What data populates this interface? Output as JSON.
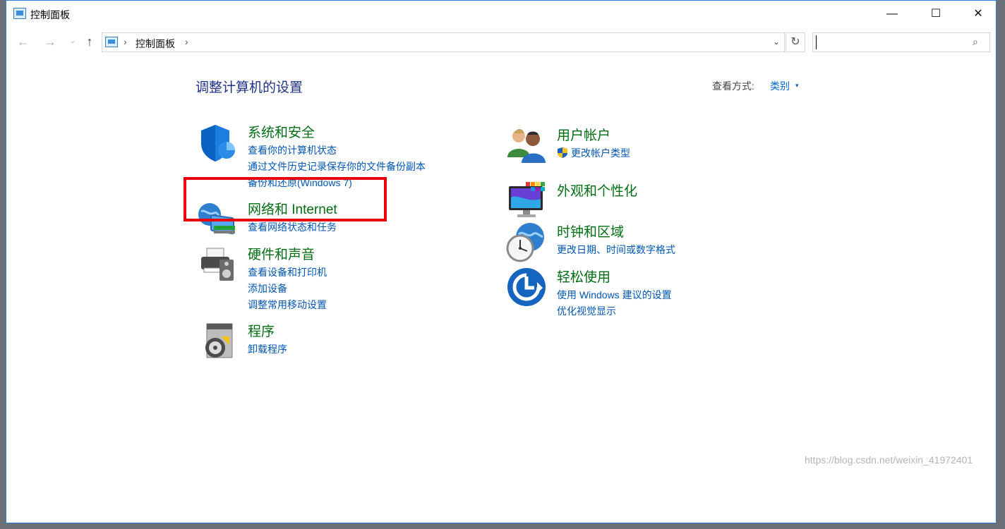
{
  "window": {
    "title": "控制面板",
    "controls": {
      "minimize": "—",
      "maximize": "☐",
      "close": "✕"
    }
  },
  "nav": {
    "back_icon": "←",
    "forward_icon": "→",
    "history_icon": "⌄",
    "up_icon": "↑",
    "breadcrumb": [
      "控制面板"
    ],
    "separator": "›",
    "dropdown_icon": "⌄",
    "refresh_icon": "↻",
    "search_placeholder": "",
    "search_icon": "⌕"
  },
  "main": {
    "heading": "调整计算机的设置",
    "view_by_label": "查看方式:",
    "view_by_value": "类别",
    "view_by_caret": "▾"
  },
  "categories": [
    {
      "title": "系统和安全",
      "icon": "shield-icon",
      "links": [
        "查看你的计算机状态",
        "通过文件历史记录保存你的文件备份副本",
        "备份和还原(Windows 7)"
      ]
    },
    {
      "title": "网络和 Internet",
      "icon": "network-globe-icon",
      "links": [
        "查看网络状态和任务"
      ]
    },
    {
      "title": "硬件和声音",
      "icon": "printer-speaker-icon",
      "links": [
        "查看设备和打印机",
        "添加设备",
        "调整常用移动设置"
      ]
    },
    {
      "title": "程序",
      "icon": "programs-disc-icon",
      "links": [
        "卸载程序"
      ]
    },
    {
      "title": "用户帐户",
      "icon": "users-icon",
      "links": [
        "更改帐户类型"
      ]
    },
    {
      "title": "外观和个性化",
      "icon": "monitor-palette-icon",
      "links": []
    },
    {
      "title": "时钟和区域",
      "icon": "clock-globe-icon",
      "links": [
        "更改日期、时间或数字格式"
      ]
    },
    {
      "title": "轻松使用",
      "icon": "ease-of-access-icon",
      "links": [
        "使用 Windows 建议的设置",
        "优化视觉显示"
      ]
    }
  ],
  "watermark": "https://blog.csdn.net/weixin_41972401",
  "colors": {
    "category_title": "#006d12",
    "link": "#0056b3",
    "heading": "#1e3287",
    "highlight": "#e8000b"
  }
}
